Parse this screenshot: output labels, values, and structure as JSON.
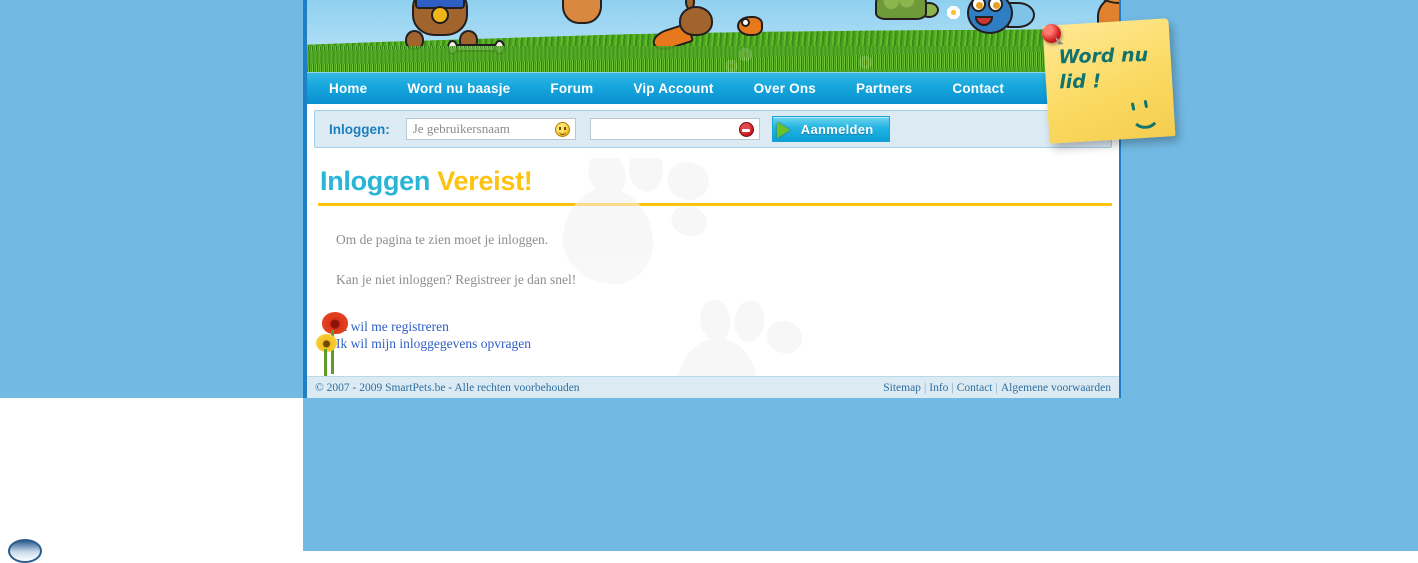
{
  "site": {
    "name": "SmartPets.be",
    "accent_cyan": "#29b5d6",
    "accent_gold": "#ffc20e",
    "background_blue": "#72b9e3",
    "nav_blue": "#17a8dd"
  },
  "nav": {
    "items": [
      {
        "label": "Home",
        "name": "nav-item-home"
      },
      {
        "label": "Word nu baasje",
        "name": "nav-item-word-nu-baasje"
      },
      {
        "label": "Forum",
        "name": "nav-item-forum"
      },
      {
        "label": "Vip Account",
        "name": "nav-item-vip-account"
      },
      {
        "label": "Over Ons",
        "name": "nav-item-over-ons"
      },
      {
        "label": "Partners",
        "name": "nav-item-partners"
      },
      {
        "label": "Contact",
        "name": "nav-item-contact"
      }
    ]
  },
  "login_bar": {
    "label": "Inloggen:",
    "username_value": "",
    "username_placeholder": "Je gebruikersnaam",
    "username_icon": "smiley-icon",
    "password_value": "",
    "password_placeholder": "",
    "password_icon": "no-entry-icon",
    "submit_label": "Aanmelden",
    "submit_icon": "green-arrow-icon"
  },
  "main": {
    "title_part1": "Inloggen",
    "title_part2": "Vereist",
    "title_part3": "!",
    "paragraph1": "Om de pagina te zien moet je inloggen.",
    "paragraph2": "Kan je niet inloggen? Registreer je dan snel!",
    "links": [
      {
        "label": "Ik wil me registreren",
        "name": "link-register"
      },
      {
        "label": "Ik wil mijn inloggegevens opvragen",
        "name": "link-recover-credentials"
      }
    ]
  },
  "sticky_note": {
    "text": "Word nu\nlid !",
    "pin": "red-pushpin-icon",
    "smiley": "smiley-face-icon"
  },
  "banner": {
    "critters": [
      "dog-illustration",
      "bone-illustration",
      "hamster-illustration",
      "rabbit-illustration",
      "carrot-illustration",
      "goldfish-illustration",
      "turtle-illustration",
      "bluefish-illustration",
      "cat-illustration",
      "ball-illustration",
      "daisy-illustration"
    ]
  },
  "footer": {
    "copyright": "© 2007 - 2009 SmartPets.be - Alle rechten voorbehouden",
    "links": [
      {
        "label": "Sitemap",
        "name": "footer-link-sitemap"
      },
      {
        "label": "Info",
        "name": "footer-link-info"
      },
      {
        "label": "Contact",
        "name": "footer-link-contact"
      },
      {
        "label": "Algemene voorwaarden",
        "name": "footer-link-algemene-voorwaarden"
      }
    ],
    "separator": "|"
  }
}
